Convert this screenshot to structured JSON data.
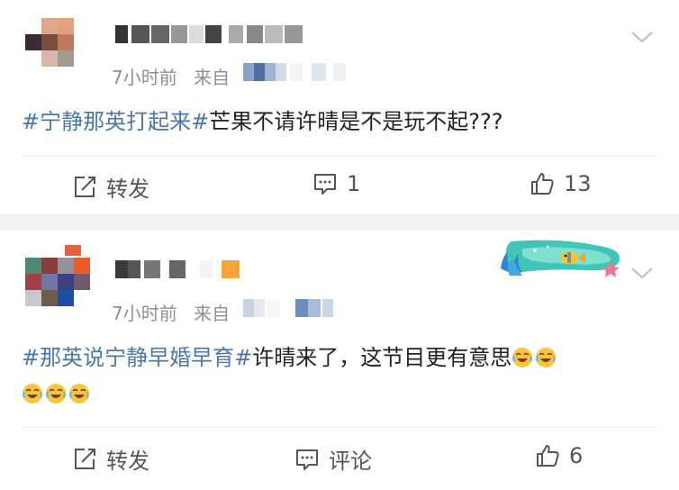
{
  "posts": [
    {
      "time": "7小时前",
      "source_prefix": "来自",
      "content_tag": "#宁静那英打起来#",
      "content_text": "芒果不请许晴是不是玩不起???",
      "actions": {
        "repost": "转发",
        "comment": "1",
        "like": "13"
      },
      "icons": [
        "chevron-down-icon",
        "repost-icon",
        "comment-icon",
        "like-icon"
      ]
    },
    {
      "time": "7小时前",
      "source_prefix": "来自",
      "content_tag": "#那英说宁静早婚早育#",
      "content_text": "许晴来了，这节目更有意思",
      "emoji": "laugh-cry-emoji",
      "actions": {
        "repost": "转发",
        "comment": "评论",
        "like": "6"
      },
      "icons": [
        "chevron-down-icon",
        "repost-icon",
        "comment-icon",
        "like-icon",
        "ocean-fish-banner"
      ]
    }
  ],
  "colors": {
    "hashtag": "#4a77ac",
    "meta": "#8f8f8f",
    "action": "#555555",
    "separator": "#f1f1f1"
  }
}
